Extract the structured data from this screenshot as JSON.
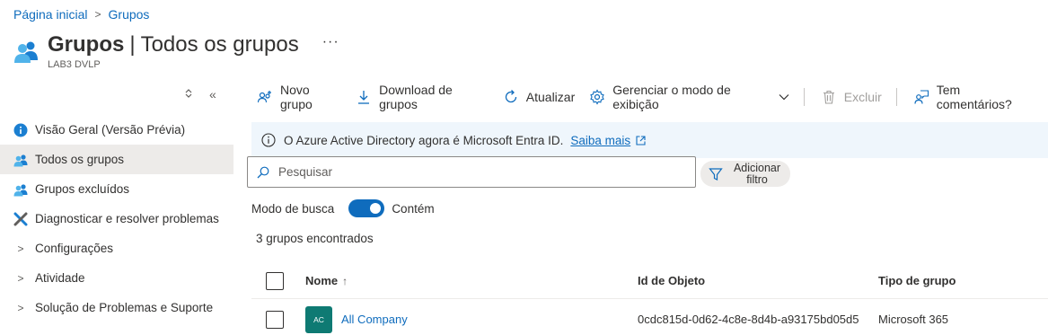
{
  "breadcrumb": {
    "home": "Página inicial",
    "current": "Grupos"
  },
  "header": {
    "title_bold": "Grupos",
    "title_sep": "|",
    "title_rest": "Todos os grupos",
    "more": "···",
    "subtitle": "LAB3 DVLP"
  },
  "sidebar_controls": {
    "expand": "⌃⌄",
    "collapse": "«"
  },
  "sidebar": {
    "items": [
      {
        "label": "Visão Geral (Versão Prévia)",
        "icon": "info-icon"
      },
      {
        "label": "Todos os grupos",
        "icon": "people-icon",
        "active": true
      },
      {
        "label": "Grupos excluídos",
        "icon": "people-icon"
      },
      {
        "label": "Diagnosticar e resolver problemas",
        "icon": "wrench-icon"
      },
      {
        "label": "Configurações",
        "icon": "chevron-right-icon"
      },
      {
        "label": "Atividade",
        "icon": "chevron-right-icon"
      },
      {
        "label": "Solução de Problemas e Suporte",
        "icon": "chevron-right-icon"
      }
    ]
  },
  "toolbar": {
    "new_group": "Novo grupo",
    "download": "Download de grupos",
    "refresh": "Atualizar",
    "manage_view": "Gerenciar o modo de exibição",
    "delete": "Excluir",
    "feedback": "Tem comentários?"
  },
  "banner": {
    "text": "O Azure Active Directory agora é Microsoft Entra ID.",
    "link": "Saiba mais"
  },
  "search": {
    "placeholder": "Pesquisar",
    "value": ""
  },
  "filter": {
    "label": "Adicionar filtro"
  },
  "search_mode": {
    "label": "Modo de busca",
    "value": "Contém",
    "enabled": true
  },
  "result_count": "3 grupos encontrados",
  "table": {
    "columns": [
      "Nome",
      "Id de Objeto",
      "Tipo de grupo"
    ],
    "sort_indicator": "↑",
    "rows": [
      {
        "initials": "AC",
        "name": "All Company",
        "id": "0cdc815d-0d62-4c8e-8d4b-a93175bd05d5",
        "type": "Microsoft 365"
      }
    ]
  },
  "colors": {
    "accent": "#0f6cbd",
    "banner_bg": "#eff6fc",
    "active_bg": "#edebe9",
    "avatar": "#0e7a73"
  }
}
